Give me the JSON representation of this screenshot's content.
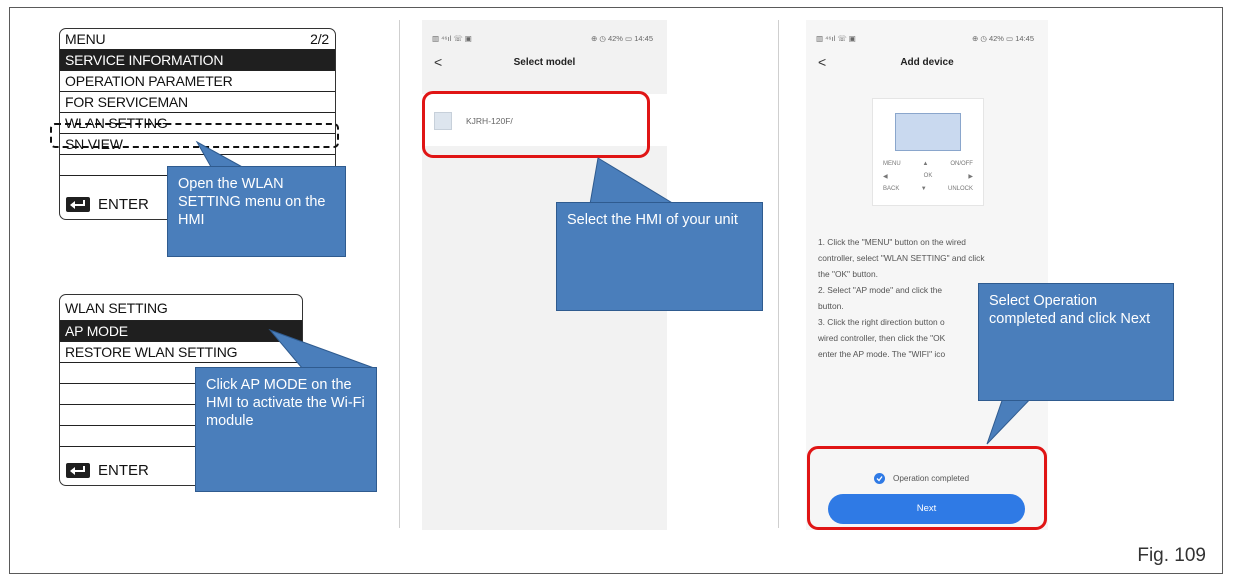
{
  "menu1": {
    "title": "MENU",
    "page": "2/2",
    "items": [
      "SERVICE INFORMATION",
      "OPERATION PARAMETER",
      "FOR SERVICEMAN",
      "WLAN SETTING",
      "SN VIEW"
    ],
    "enter": "ENTER"
  },
  "menu2": {
    "items": [
      "WLAN SETTING",
      "AP MODE",
      "RESTORE WLAN SETTING"
    ],
    "enter": "ENTER"
  },
  "callouts": {
    "c1": "Open the WLAN SETTING menu on the HMI",
    "c2": "Click AP MODE on the HMI to activate the Wi-Fi module",
    "c3": "Select the HMI of your unit",
    "c4": "Select Operation completed and click Next"
  },
  "phone1": {
    "status_left": "▥ ⁴⁶ıl ☏ ▣",
    "status_right": "⊕ ◷ 42% ▭ 14:45",
    "back": "<",
    "title": "Select model",
    "model": "KJRH-120F/"
  },
  "phone2": {
    "status_left": "▥ ⁴⁶ıl ☏ ▣",
    "status_right": "⊕ ◷ 42% ▭ 14:45",
    "back": "<",
    "title": "Add device",
    "device_keys": [
      "MENU",
      "▲",
      "ON/OFF",
      "◀",
      "OK",
      "▶",
      "BACK",
      "▼",
      "UNLOCK"
    ],
    "steps": [
      "1. Click the \"MENU\" button on the wired",
      "controller, select \"WLAN SETTING\" and click",
      "the \"OK\" button.",
      "2. Select \"AP mode\" and click the",
      "button.",
      "3. Click the right direction button o",
      "wired controller, then click the \"OK",
      "enter the AP mode. The \"WIFI\" ico"
    ],
    "check_label": "Operation completed",
    "next": "Next"
  },
  "figure_label": "Fig. 109"
}
